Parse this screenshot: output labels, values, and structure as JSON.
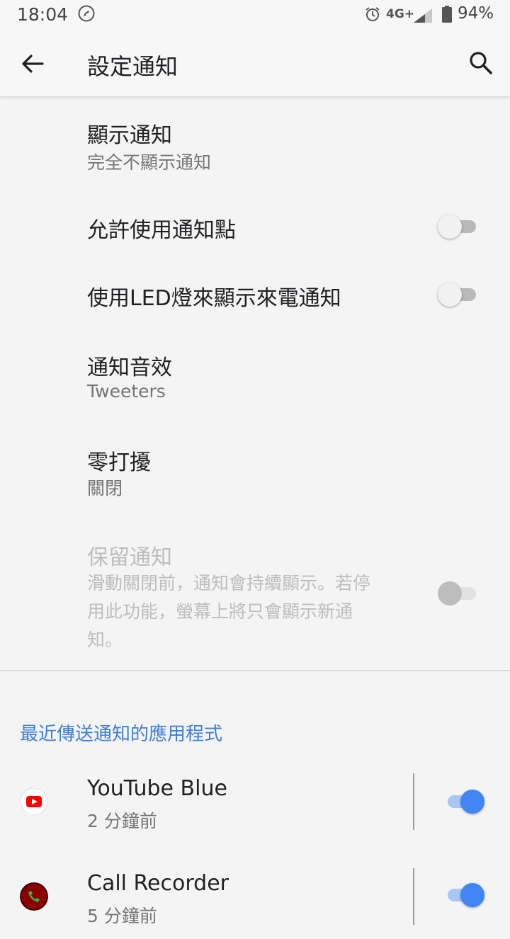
{
  "status_bar": {
    "time": "18:04",
    "network": "4G+",
    "battery": "94%"
  },
  "app_bar": {
    "title": "設定通知",
    "back_icon": "arrow-back-icon",
    "search_icon": "search-icon"
  },
  "settings": [
    {
      "title": "顯示通知",
      "subtitle": "完全不顯示通知"
    },
    {
      "title": "允許使用通知點",
      "toggle": false
    },
    {
      "title": "使用LED燈來顯示來電通知",
      "toggle": false
    },
    {
      "title": "通知音效",
      "subtitle": "Tweeters"
    },
    {
      "title": "零打擾",
      "subtitle": "關閉"
    },
    {
      "title": "保留通知",
      "subtitle_lines": [
        "滑動關閉前，通知會持續顯示。若停",
        "用此功能，螢幕上將只會顯示新通",
        "知。"
      ],
      "toggle": false,
      "disabled": true
    }
  ],
  "recent_section": {
    "header": "最近傳送通知的應用程式",
    "apps": [
      {
        "name": "YouTube Blue",
        "time": "2 分鐘前",
        "enabled": true,
        "icon": "youtube-icon"
      },
      {
        "name": "Call Recorder",
        "time": "5 分鐘前",
        "enabled": true,
        "icon": "call-recorder-icon"
      }
    ]
  },
  "colors": {
    "accent": "#4285f4",
    "section_header": "#3f7fd9",
    "youtube_red": "#ff0000",
    "call_recorder_red": "#8b0000"
  }
}
